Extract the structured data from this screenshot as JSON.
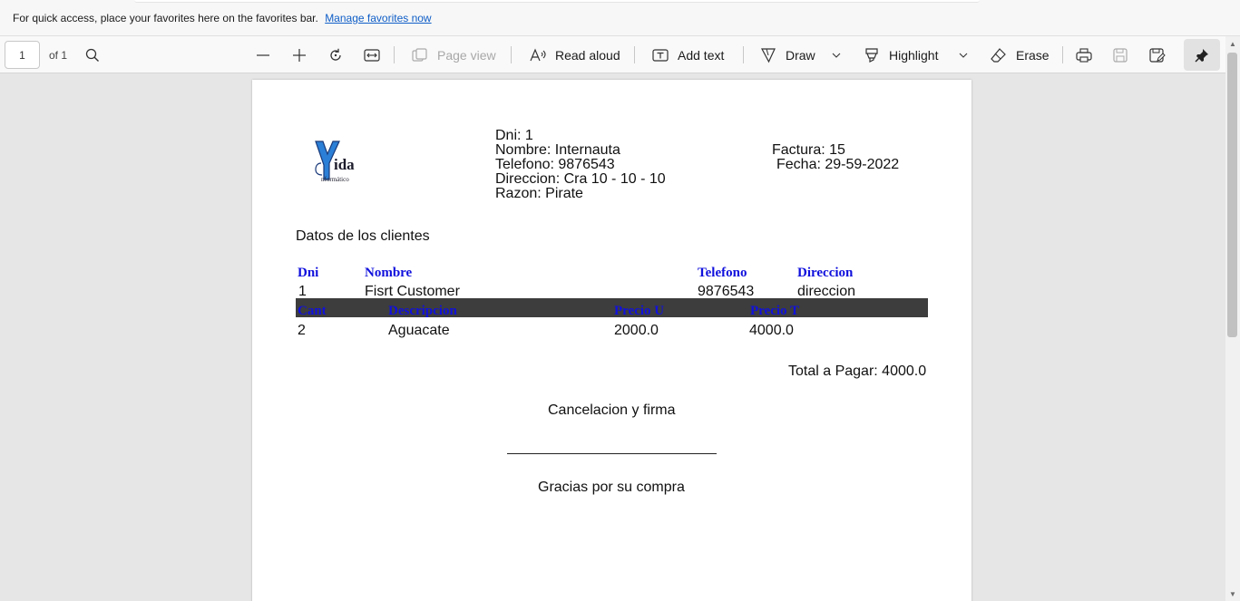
{
  "favorites_bar": {
    "message": "For quick access, place your favorites here on the favorites bar.",
    "link": "Manage favorites now"
  },
  "toolbar": {
    "page_number": "1",
    "page_count": "of 1",
    "page_view": "Page view",
    "read_aloud": "Read aloud",
    "add_text": "Add text",
    "draw": "Draw",
    "highlight": "Highlight",
    "erase": "Erase"
  },
  "invoice": {
    "logo": {
      "text": "ida",
      "subtext": "nformático"
    },
    "customer_block": {
      "dni": "Dni: 1",
      "nombre": "Nombre: Internauta",
      "telefono": "Telefono: 9876543",
      "direccion": "Direccion: Cra 10 - 10 - 10",
      "razon": "Razon: Pirate"
    },
    "factura": "Factura: 15",
    "fecha": "Fecha: 29-59-2022",
    "section_title": "Datos de los clientes",
    "client_headers": [
      "Dni",
      "Nombre",
      "Telefono",
      "Direccion"
    ],
    "client_row": [
      "1",
      "Fisrt Customer",
      "9876543",
      "direccion"
    ],
    "item_headers": [
      "Cant",
      "Descripcion",
      "Precio U",
      "Precio T"
    ],
    "item_row": [
      "2",
      "Aguacate",
      "2000.0",
      "4000.0"
    ],
    "total": "Total a Pagar: 4000.0",
    "cancel_label": "Cancelacion y firma",
    "thanks": "Gracias por su compra"
  }
}
